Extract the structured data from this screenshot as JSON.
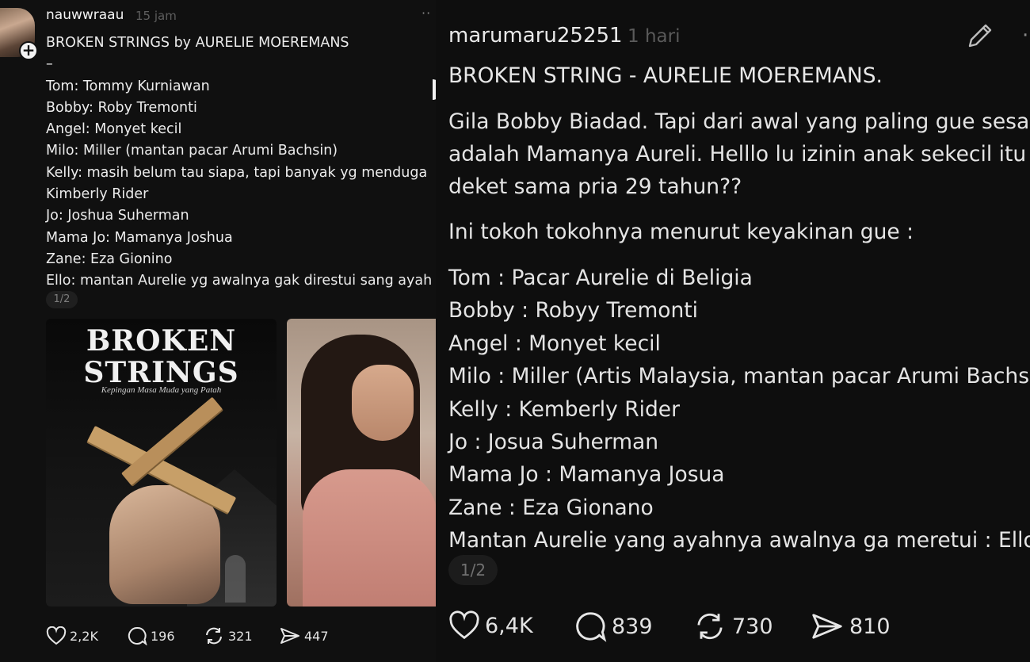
{
  "left_post": {
    "username": "nauwwraau",
    "time": "15 jam",
    "more": "··",
    "lines": [
      "BROKEN STRINGS by AURELIE MOEREMANS",
      "–",
      "Tom: Tommy Kurniawan",
      "Bobby: Roby Tremonti",
      "Angel: Monyet kecil",
      "Milo: Miller (mantan pacar Arumi Bachsin)",
      "Kelly: masih belum tau siapa, tapi banyak yg menduga",
      "Kimberly Rider",
      "Jo: Joshua Suherman",
      "Mama Jo: Mamanya Joshua",
      "Zane: Eza Gionino",
      "Ello: mantan Aurelie yg awalnya gak direstui sang ayah"
    ],
    "page_indicator": "1/2",
    "book_cover": {
      "title_line1": "BROKEN",
      "title_line2": "STRINGS",
      "subtitle": "Kepingan Masa Muda yang Patah"
    },
    "actions": {
      "likes": "2,2K",
      "comments": "196",
      "reposts": "321",
      "shares": "447"
    }
  },
  "right_post": {
    "username": "marumaru25251",
    "time": "1 hari",
    "more": "·",
    "headline": "BROKEN STRING - AURELIE MOEREMANS.",
    "paragraph_lines": [
      "Gila Bobby Biadad. Tapi dari awal yang paling gue sesal",
      "adalah Mamanya Aureli. Helllo lu izinin anak sekecil itu",
      "deket sama pria 29 tahun??"
    ],
    "intro": "Ini tokoh tokohnya menurut keyakinan gue :",
    "list": [
      "Tom : Pacar Aurelie di Beligia",
      "Bobby : Robyy Tremonti",
      "Angel : Monyet kecil",
      "Milo : Miller (Artis Malaysia, mantan pacar Arumi Bachs",
      "Kelly : Kemberly Rider",
      "Jo : Josua Suherman",
      "Mama Jo : Mamanya Josua",
      "Zane : Eza Gionano",
      "Mantan Aurelie yang ayahnya awalnya ga meretui : Ello"
    ],
    "page_indicator": "1/2",
    "actions": {
      "likes": "6,4K",
      "comments": "839",
      "reposts": "730",
      "shares": "810"
    }
  }
}
